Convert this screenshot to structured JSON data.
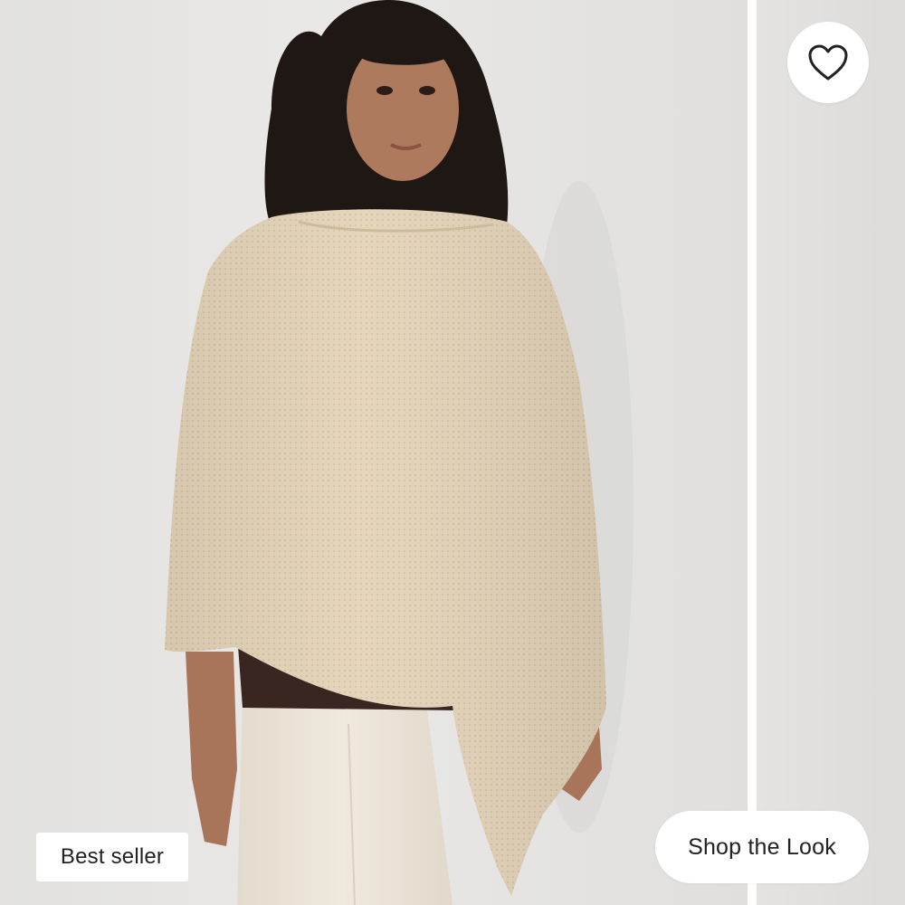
{
  "product_card": {
    "badge_label": "Best seller",
    "shop_button_label": "Shop the Look",
    "favorite_icon": "heart-outline-icon",
    "image_alt": ""
  },
  "colors": {
    "wall": "#e7e6e4",
    "divider": "#ffffff",
    "poncho": "#e2d2b6",
    "top": "#3a2620",
    "pants": "#ece6da",
    "button_text": "#222222"
  }
}
